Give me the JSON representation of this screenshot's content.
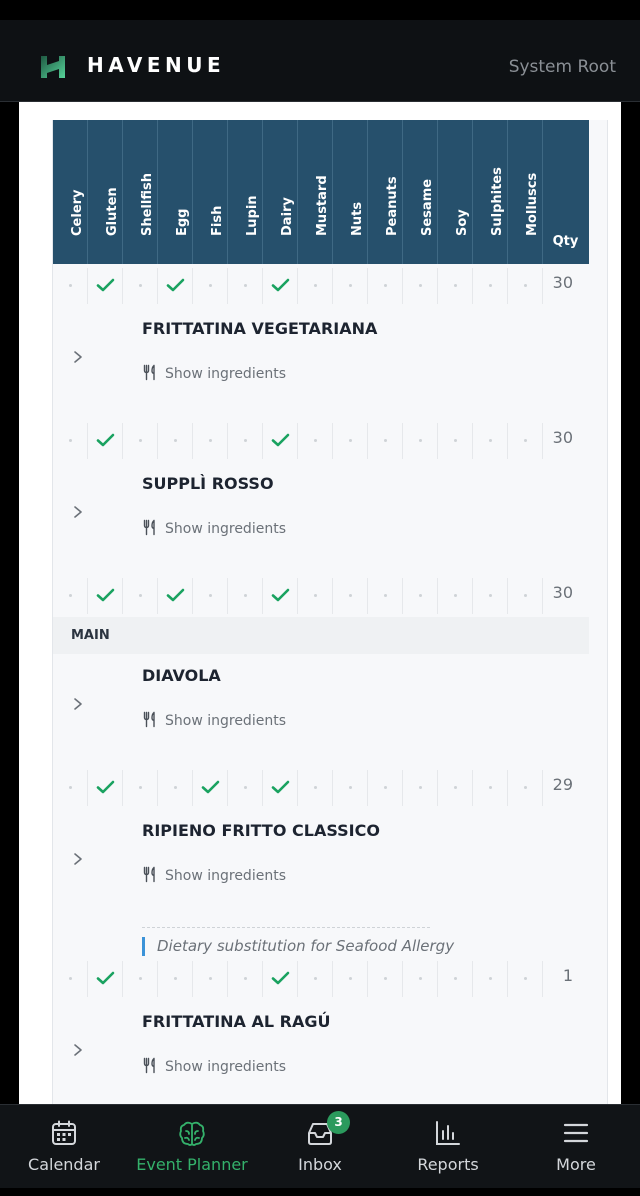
{
  "header": {
    "brand": "HAVENUE",
    "user": "System Root"
  },
  "allergens": [
    "Celery",
    "Gluten",
    "Shellfish",
    "Egg",
    "Fish",
    "Lupin",
    "Dairy",
    "Mustard",
    "Nuts",
    "Peanuts",
    "Sesame",
    "Soy",
    "Sulphites",
    "Molluscs"
  ],
  "qty_label": "Qty",
  "show_ingredients_label": "Show ingredients",
  "rows": [
    {
      "kind": "marks",
      "checks": [
        "Gluten",
        "Egg",
        "Dairy"
      ],
      "qty": "30"
    },
    {
      "kind": "dish",
      "name": "FRITTATINA VEGETARIANA"
    },
    {
      "kind": "marks",
      "checks": [
        "Gluten",
        "Dairy"
      ],
      "qty": "30"
    },
    {
      "kind": "dish",
      "name": "SUPPLÌ ROSSO"
    },
    {
      "kind": "marks",
      "checks": [
        "Gluten",
        "Egg",
        "Dairy"
      ],
      "qty": "30"
    },
    {
      "kind": "section",
      "label": "MAIN"
    },
    {
      "kind": "dish",
      "name": "DIAVOLA"
    },
    {
      "kind": "marks",
      "checks": [
        "Gluten",
        "Fish",
        "Dairy"
      ],
      "qty": "29"
    },
    {
      "kind": "dish",
      "name": "RIPIENO FRITTO CLASSICO",
      "note": "Dietary substitution for Seafood Allergy"
    },
    {
      "kind": "marks",
      "checks": [
        "Gluten",
        "Dairy"
      ],
      "qty": "1"
    },
    {
      "kind": "dish",
      "name": "FRITTATINA AL RAGÚ"
    }
  ],
  "nav": [
    {
      "label": "Calendar",
      "icon": "calendar-icon",
      "active": false
    },
    {
      "label": "Event Planner",
      "icon": "brain-icon",
      "active": true
    },
    {
      "label": "Inbox",
      "icon": "inbox-icon",
      "active": false,
      "badge": "3"
    },
    {
      "label": "Reports",
      "icon": "bar-chart-icon",
      "active": false
    },
    {
      "label": "More",
      "icon": "menu-icon",
      "active": false
    }
  ],
  "colors": {
    "header_bg": "#0e1114",
    "table_head": "#26506c",
    "check": "#1aa260",
    "accent_active": "#34b16b",
    "badge": "#2b9a5d",
    "note_border": "#3b93d8"
  }
}
